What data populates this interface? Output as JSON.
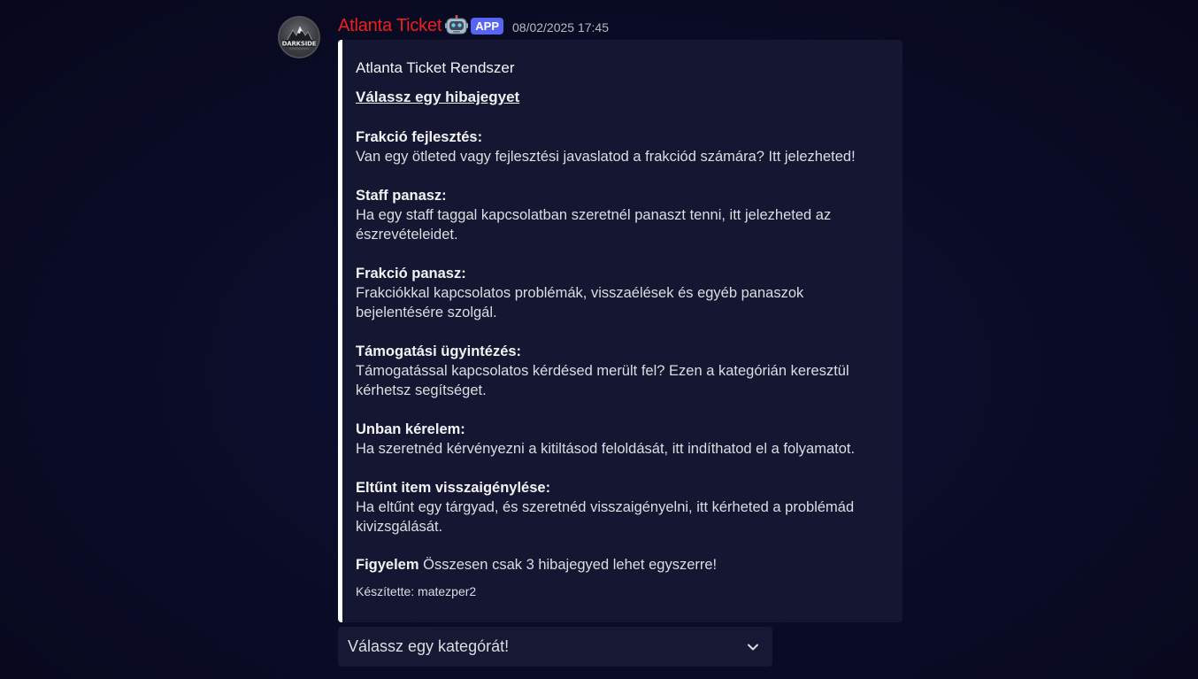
{
  "message": {
    "author": "Atlanta Ticket",
    "author_color": "#f21d1d",
    "badge": "APP",
    "timestamp": "08/02/2025 17:45",
    "avatar_text": "DARKSIDE",
    "bot_icon": "robot-face-icon"
  },
  "embed": {
    "accent_color": "#ffffff",
    "author": "Atlanta Ticket Rendszer",
    "title": "Válassz egy hibajegyet",
    "sections": [
      {
        "heading": "Frakció fejlesztés:",
        "text": "Van egy ötleted vagy fejlesztési javaslatod a frakciód számára? Itt jelezheted!"
      },
      {
        "heading": "Staff panasz:",
        "text": "Ha egy staff taggal kapcsolatban szeretnél panaszt tenni, itt jelezheted az észrevételeidet."
      },
      {
        "heading": "Frakció panasz:",
        "text": "Frakciókkal kapcsolatos problémák, visszaélések és egyéb panaszok bejelentésére szolgál."
      },
      {
        "heading": "Támogatási ügyintézés:",
        "text": "Támogatással kapcsolatos kérdésed merült fel? Ezen a kategórián keresztül kérhetsz segítséget."
      },
      {
        "heading": "Unban kérelem:",
        "text": "Ha szeretnéd kérvényezni a kitiltásod feloldását, itt indíthatod el a folyamatot."
      },
      {
        "heading": "Eltűnt item visszaigénylése:",
        "text": "Ha eltűnt egy tárgyad, és szeretnéd visszaigényelni, itt kérheted a problémád kivizsgálását."
      }
    ],
    "note_bold": "Figyelem",
    "note_text": " Összesen csak 3 hibajegyed lehet egyszerre!",
    "footer": "Készítette: matezper2"
  },
  "select": {
    "placeholder": "Válassz egy kategórát!",
    "icon": "chevron-down-icon"
  }
}
